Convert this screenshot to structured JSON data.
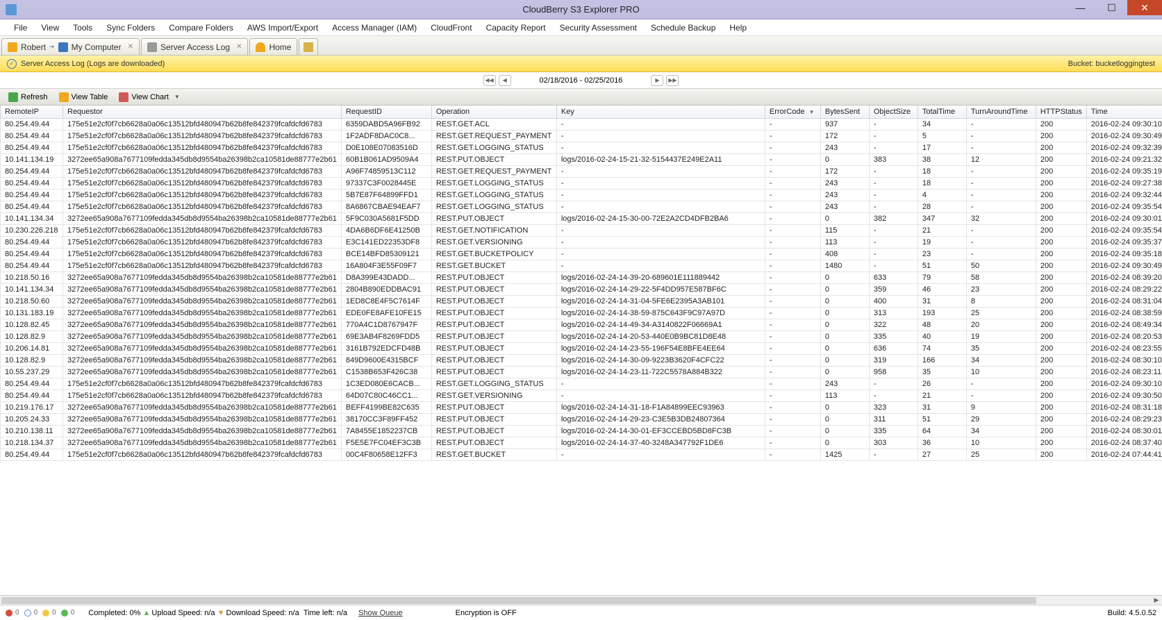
{
  "window": {
    "title": "CloudBerry S3 Explorer PRO"
  },
  "menu": [
    "File",
    "View",
    "Tools",
    "Sync Folders",
    "Compare Folders",
    "AWS Import/Export",
    "Access Manager (IAM)",
    "CloudFront",
    "Capacity Report",
    "Security Assessment",
    "Schedule Backup",
    "Help"
  ],
  "tabs": [
    {
      "label": "Robert",
      "sub": "My Computer"
    },
    {
      "label": "Server Access Log"
    },
    {
      "label": "Home"
    }
  ],
  "infobar": {
    "text": "Server Access Log (Logs are downloaded)",
    "bucket": "Bucket: bucketloggingtest"
  },
  "datebar": {
    "range": "02/18/2016 - 02/25/2016"
  },
  "toolbar": {
    "refresh": "Refresh",
    "view_table": "View Table",
    "view_chart": "View Chart"
  },
  "columns": [
    "RemoteIP",
    "Requestor",
    "RequestID",
    "Operation",
    "Key",
    "ErrorCode",
    "BytesSent",
    "ObjectSize",
    "TotalTime",
    "TurnAroundTime",
    "HTTPStatus",
    "Time"
  ],
  "rows": [
    [
      "80.254.49.44",
      "175e51e2cf0f7cb6628a0a06c13512bfd480947b62b8fe842379fcafdcfd6783",
      "6359DABD5A96FB92",
      "REST.GET.ACL",
      "-",
      "-",
      "937",
      "-",
      "34",
      "-",
      "200",
      "2016-02-24 09:30:10"
    ],
    [
      "80.254.49.44",
      "175e51e2cf0f7cb6628a0a06c13512bfd480947b62b8fe842379fcafdcfd6783",
      "1F2ADF8DAC0C8...",
      "REST.GET.REQUEST_PAYMENT",
      "-",
      "-",
      "172",
      "-",
      "5",
      "-",
      "200",
      "2016-02-24 09:30:49"
    ],
    [
      "80.254.49.44",
      "175e51e2cf0f7cb6628a0a06c13512bfd480947b62b8fe842379fcafdcfd6783",
      "D0E108E07083516D",
      "REST.GET.LOGGING_STATUS",
      "-",
      "-",
      "243",
      "-",
      "17",
      "-",
      "200",
      "2016-02-24 09:32:39"
    ],
    [
      "10.141.134.19",
      "3272ee65a908a7677109fedda345db8d9554ba26398b2ca10581de88777e2b61",
      "60B1B061AD9509A4",
      "REST.PUT.OBJECT",
      "logs/2016-02-24-15-21-32-5154437E249E2A11",
      "-",
      "0",
      "383",
      "38",
      "12",
      "200",
      "2016-02-24 09:21:32"
    ],
    [
      "80.254.49.44",
      "175e51e2cf0f7cb6628a0a06c13512bfd480947b62b8fe842379fcafdcfd6783",
      "A96F74859513C112",
      "REST.GET.REQUEST_PAYMENT",
      "-",
      "-",
      "172",
      "-",
      "18",
      "-",
      "200",
      "2016-02-24 09:35:19"
    ],
    [
      "80.254.49.44",
      "175e51e2cf0f7cb6628a0a06c13512bfd480947b62b8fe842379fcafdcfd6783",
      "97337C3F0028445E",
      "REST.GET.LOGGING_STATUS",
      "-",
      "-",
      "243",
      "-",
      "18",
      "-",
      "200",
      "2016-02-24 09:27:38"
    ],
    [
      "80.254.49.44",
      "175e51e2cf0f7cb6628a0a06c13512bfd480947b62b8fe842379fcafdcfd6783",
      "5B7E87F64899FFD1",
      "REST.GET.LOGGING_STATUS",
      "-",
      "-",
      "243",
      "-",
      "4",
      "-",
      "200",
      "2016-02-24 09:32:44"
    ],
    [
      "80.254.49.44",
      "175e51e2cf0f7cb6628a0a06c13512bfd480947b62b8fe842379fcafdcfd6783",
      "8A6867CBAE94EAF7",
      "REST.GET.LOGGING_STATUS",
      "-",
      "-",
      "243",
      "-",
      "28",
      "-",
      "200",
      "2016-02-24 09:35:54"
    ],
    [
      "10.141.134.34",
      "3272ee65a908a7677109fedda345db8d9554ba26398b2ca10581de88777e2b61",
      "5F9C030A5681F5DD",
      "REST.PUT.OBJECT",
      "logs/2016-02-24-15-30-00-72E2A2CD4DFB2BA6",
      "-",
      "0",
      "382",
      "347",
      "32",
      "200",
      "2016-02-24 09:30:01"
    ],
    [
      "10.230.226.218",
      "175e51e2cf0f7cb6628a0a06c13512bfd480947b62b8fe842379fcafdcfd6783",
      "4DA6B6DF6E41250B",
      "REST.GET.NOTIFICATION",
      "-",
      "-",
      "115",
      "-",
      "21",
      "-",
      "200",
      "2016-02-24 09:35:54"
    ],
    [
      "80.254.49.44",
      "175e51e2cf0f7cb6628a0a06c13512bfd480947b62b8fe842379fcafdcfd6783",
      "E3C141ED22353DF8",
      "REST.GET.VERSIONING",
      "-",
      "-",
      "113",
      "-",
      "19",
      "-",
      "200",
      "2016-02-24 09:35:37"
    ],
    [
      "80.254.49.44",
      "175e51e2cf0f7cb6628a0a06c13512bfd480947b62b8fe842379fcafdcfd6783",
      "BCE14BFD85309121",
      "REST.GET.BUCKETPOLICY",
      "-",
      "-",
      "408",
      "-",
      "23",
      "-",
      "200",
      "2016-02-24 09:35:18"
    ],
    [
      "80.254.49.44",
      "175e51e2cf0f7cb6628a0a06c13512bfd480947b62b8fe842379fcafdcfd6783",
      "16A804F3E55F09F7",
      "REST.GET.BUCKET",
      "-",
      "-",
      "1480",
      "-",
      "51",
      "50",
      "200",
      "2016-02-24 09:30:49"
    ],
    [
      "10.218.50.16",
      "3272ee65a908a7677109fedda345db8d9554ba26398b2ca10581de88777e2b61",
      "D8A399E43DADD...",
      "REST.PUT.OBJECT",
      "logs/2016-02-24-14-39-20-689601E111889442",
      "-",
      "0",
      "633",
      "79",
      "58",
      "200",
      "2016-02-24 08:39:20"
    ],
    [
      "10.141.134.34",
      "3272ee65a908a7677109fedda345db8d9554ba26398b2ca10581de88777e2b61",
      "2804B890EDDBAC91",
      "REST.PUT.OBJECT",
      "logs/2016-02-24-14-29-22-5F4DD957E587BF6C",
      "-",
      "0",
      "359",
      "46",
      "23",
      "200",
      "2016-02-24 08:29:22"
    ],
    [
      "10.218.50.60",
      "3272ee65a908a7677109fedda345db8d9554ba26398b2ca10581de88777e2b61",
      "1ED8C8E4F5C7614F",
      "REST.PUT.OBJECT",
      "logs/2016-02-24-14-31-04-5FE6E2395A3AB101",
      "-",
      "0",
      "400",
      "31",
      "8",
      "200",
      "2016-02-24 08:31:04"
    ],
    [
      "10.131.183.19",
      "3272ee65a908a7677109fedda345db8d9554ba26398b2ca10581de88777e2b61",
      "EDE0FE8AFE10FE15",
      "REST.PUT.OBJECT",
      "logs/2016-02-24-14-38-59-875C643F9C97A97D",
      "-",
      "0",
      "313",
      "193",
      "25",
      "200",
      "2016-02-24 08:38:59"
    ],
    [
      "10.128.82.45",
      "3272ee65a908a7677109fedda345db8d9554ba26398b2ca10581de88777e2b61",
      "770A4C1D8767947F",
      "REST.PUT.OBJECT",
      "logs/2016-02-24-14-49-34-A3140822F06669A1",
      "-",
      "0",
      "322",
      "48",
      "20",
      "200",
      "2016-02-24 08:49:34"
    ],
    [
      "10.128.82.9",
      "3272ee65a908a7677109fedda345db8d9554ba26398b2ca10581de88777e2b61",
      "69E3AB4F8269FDD5",
      "REST.PUT.OBJECT",
      "logs/2016-02-24-14-20-53-440E0B9BC81D8E48",
      "-",
      "0",
      "335",
      "40",
      "19",
      "200",
      "2016-02-24 08:20:53"
    ],
    [
      "10.206.14.81",
      "3272ee65a908a7677109fedda345db8d9554ba26398b2ca10581de88777e2b61",
      "3161B792EDCFD48B",
      "REST.PUT.OBJECT",
      "logs/2016-02-24-14-23-55-196F54E8BFE4EE64",
      "-",
      "0",
      "636",
      "74",
      "35",
      "200",
      "2016-02-24 08:23:55"
    ],
    [
      "10.128.82.9",
      "3272ee65a908a7677109fedda345db8d9554ba26398b2ca10581de88777e2b61",
      "849D9600E4315BCF",
      "REST.PUT.OBJECT",
      "logs/2016-02-24-14-30-09-9223B3620F4CFC22",
      "-",
      "0",
      "319",
      "166",
      "34",
      "200",
      "2016-02-24 08:30:10"
    ],
    [
      "10.55.237.29",
      "3272ee65a908a7677109fedda345db8d9554ba26398b2ca10581de88777e2b61",
      "C1538B653F426C38",
      "REST.PUT.OBJECT",
      "logs/2016-02-24-14-23-11-722C5578A884B322",
      "-",
      "0",
      "958",
      "35",
      "10",
      "200",
      "2016-02-24 08:23:11"
    ],
    [
      "80.254.49.44",
      "175e51e2cf0f7cb6628a0a06c13512bfd480947b62b8fe842379fcafdcfd6783",
      "1C3ED080E6CACB...",
      "REST.GET.LOGGING_STATUS",
      "-",
      "-",
      "243",
      "-",
      "26",
      "-",
      "200",
      "2016-02-24 09:30:10"
    ],
    [
      "80.254.49.44",
      "175e51e2cf0f7cb6628a0a06c13512bfd480947b62b8fe842379fcafdcfd6783",
      "64D07C80C46CC1...",
      "REST.GET.VERSIONING",
      "-",
      "-",
      "113",
      "-",
      "21",
      "-",
      "200",
      "2016-02-24 09:30:50"
    ],
    [
      "10.219.176.17",
      "3272ee65a908a7677109fedda345db8d9554ba26398b2ca10581de88777e2b61",
      "BEFF4199BE82C635",
      "REST.PUT.OBJECT",
      "logs/2016-02-24-14-31-18-F1A84899EEC93963",
      "-",
      "0",
      "323",
      "31",
      "9",
      "200",
      "2016-02-24 08:31:18"
    ],
    [
      "10.205.24.33",
      "3272ee65a908a7677109fedda345db8d9554ba26398b2ca10581de88777e2b61",
      "38170CC3F89FF452",
      "REST.PUT.OBJECT",
      "logs/2016-02-24-14-29-23-C3E5B3DB24807364",
      "-",
      "0",
      "311",
      "51",
      "29",
      "200",
      "2016-02-24 08:29:23"
    ],
    [
      "10.210.138.11",
      "3272ee65a908a7677109fedda345db8d9554ba26398b2ca10581de88777e2b61",
      "7A8455E1852237CB",
      "REST.PUT.OBJECT",
      "logs/2016-02-24-14-30-01-EF3CCEBD5BD8FC3B",
      "-",
      "0",
      "335",
      "64",
      "34",
      "200",
      "2016-02-24 08:30:01"
    ],
    [
      "10.218.134.37",
      "3272ee65a908a7677109fedda345db8d9554ba26398b2ca10581de88777e2b61",
      "F5E5E7FC04EF3C3B",
      "REST.PUT.OBJECT",
      "logs/2016-02-24-14-37-40-3248A347792F1DE6",
      "-",
      "0",
      "303",
      "36",
      "10",
      "200",
      "2016-02-24 08:37:40"
    ],
    [
      "80.254.49.44",
      "175e51e2cf0f7cb6628a0a06c13512bfd480947b62b8fe842379fcafdcfd6783",
      "00C4F80658E12FF3",
      "REST.GET.BUCKET",
      "-",
      "-",
      "1425",
      "-",
      "27",
      "25",
      "200",
      "2016-02-24 07:44:41"
    ]
  ],
  "status": {
    "completed": "Completed: 0%",
    "upload": "Upload Speed: n/a",
    "download": "Download Speed: n/a",
    "time_left": "Time left: n/a",
    "show_queue": "Show Queue",
    "encryption": "Encryption is OFF",
    "build": "Build: 4.5.0.52"
  }
}
